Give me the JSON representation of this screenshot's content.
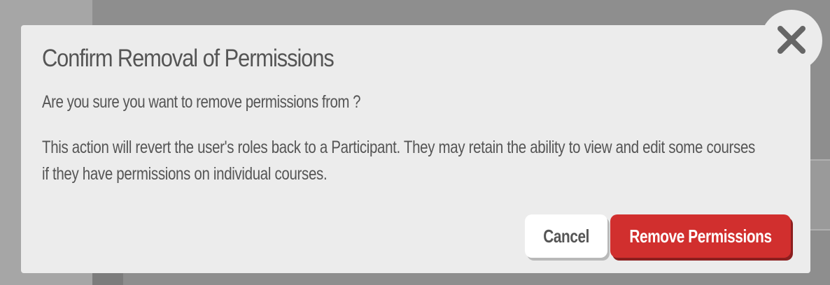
{
  "dialog": {
    "title": "Confirm Removal of Permissions",
    "question": "Are you sure you want to remove permissions from ?",
    "description": "This action will revert the user's roles back to a Participant. They may retain the ability to view and edit some courses if they have permissions on individual courses.",
    "cancel_label": "Cancel",
    "confirm_label": "Remove Permissions",
    "close_icon": "close-icon"
  },
  "colors": {
    "overlay": "#8e8e8e",
    "dialog_background": "#ececec",
    "text": "#555555",
    "danger": "#d12f2e",
    "cancel_background": "#ffffff"
  }
}
